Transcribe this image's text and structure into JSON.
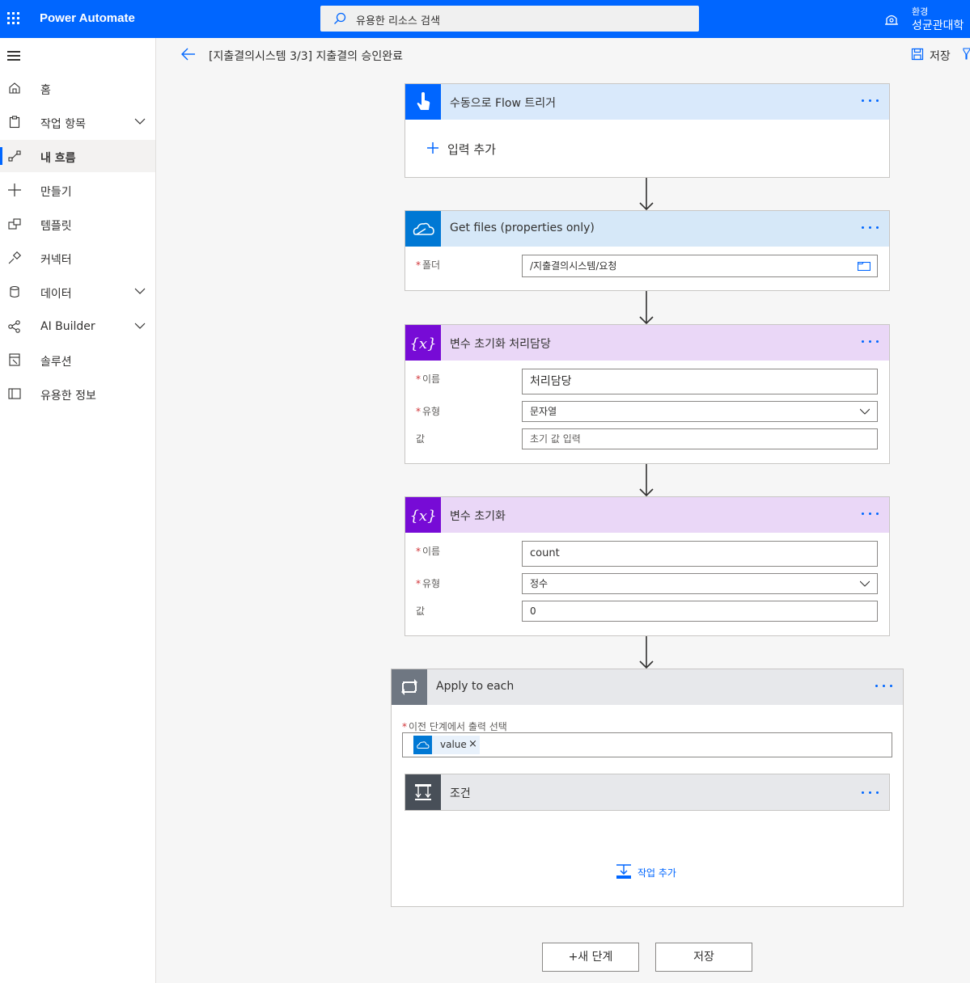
{
  "app": {
    "name": "Power Automate"
  },
  "search": {
    "placeholder": "유용한 리소스 검색"
  },
  "environment": {
    "label": "환경",
    "name": "성균관대학"
  },
  "sidebar": {
    "items": [
      {
        "label": "홈",
        "icon": "home-icon"
      },
      {
        "label": "작업 항목",
        "icon": "clipboard-icon",
        "expandable": true
      },
      {
        "label": "내 흐름",
        "icon": "flow-icon",
        "active": true
      },
      {
        "label": "만들기",
        "icon": "plus-icon"
      },
      {
        "label": "템플릿",
        "icon": "template-icon"
      },
      {
        "label": "커넥터",
        "icon": "connector-icon"
      },
      {
        "label": "데이터",
        "icon": "database-icon",
        "expandable": true
      },
      {
        "label": "AI Builder",
        "icon": "ai-builder-icon",
        "expandable": true
      },
      {
        "label": "솔루션",
        "icon": "solution-icon"
      },
      {
        "label": "유용한 정보",
        "icon": "book-icon"
      }
    ]
  },
  "header": {
    "flow_title": "[지출결의시스템 3/3] 지출결의 승인완료",
    "save_label": "저장"
  },
  "steps": {
    "trigger": {
      "title": "수동으로 Flow 트리거",
      "add_input": "입력 추가",
      "color": "#0066ff"
    },
    "get_files": {
      "title": "Get files (properties only)",
      "folder_label": "폴더",
      "folder_value": "/지출결의시스템/요청",
      "color": "#0078d4"
    },
    "init_var1": {
      "title": "변수 초기화 처리담당",
      "name_label": "이름",
      "name_value": "처리담당",
      "type_label": "유형",
      "type_value": "문자열",
      "value_label": "값",
      "value_placeholder": "초기 값 입력",
      "color": "#770bd6"
    },
    "init_var2": {
      "title": "변수 초기화",
      "name_label": "이름",
      "name_value": "count",
      "type_label": "유형",
      "type_value": "정수",
      "value_label": "값",
      "value_value": "0",
      "color": "#770bd6"
    },
    "apply_each": {
      "title": "Apply to each",
      "output_label": "이전 단계에서 출력 선택",
      "token": "value",
      "color": "#486991",
      "condition": {
        "title": "조건",
        "color": "#484f58"
      },
      "add_action": "작업 추가"
    }
  },
  "footer": {
    "new_step": "+새 단계",
    "save": "저장"
  }
}
